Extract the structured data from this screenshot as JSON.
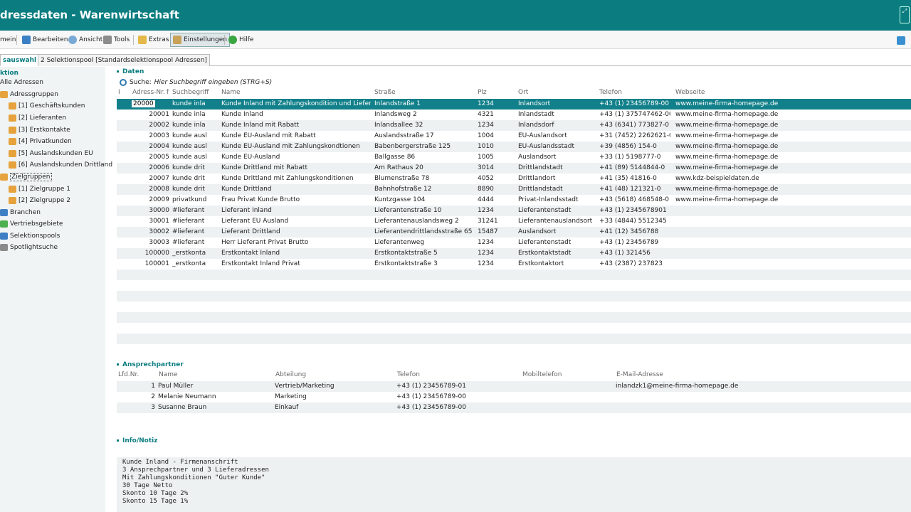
{
  "window": {
    "title": "dressdaten - Warenwirtschaft",
    "restore_glyph": "⤢"
  },
  "menubar": [
    {
      "label": "mein",
      "icon": ""
    },
    {
      "label": "Bearbeiten",
      "icon": "edit-icon"
    },
    {
      "label": "Ansicht",
      "icon": "view-icon"
    },
    {
      "label": "Tools",
      "icon": "tools-icon"
    },
    {
      "label": "Extras",
      "icon": "extras-icon"
    },
    {
      "label": "Einstellungen",
      "icon": "settings-icon"
    },
    {
      "label": "Hilfe",
      "icon": "help-icon"
    }
  ],
  "tabs": [
    {
      "label": "sauswahl"
    },
    {
      "label": "2 Selektionspool [Standardselektionspool Adressen]"
    }
  ],
  "sidebar": {
    "heading": "ktion",
    "items": [
      {
        "label": "Alle Adressen"
      },
      {
        "label": "Adressgruppen"
      },
      {
        "label": "[1] Geschäftskunden"
      },
      {
        "label": "[2] Lieferanten"
      },
      {
        "label": "[3] Erstkontakte"
      },
      {
        "label": "[4] Privatkunden"
      },
      {
        "label": "[5] Auslandskunden EU"
      },
      {
        "label": "[6] Auslandskunden Drittland"
      },
      {
        "label": "Zielgruppen"
      },
      {
        "label": "[1] Zielgruppe 1"
      },
      {
        "label": "[2] Zielgruppe 2"
      },
      {
        "label": "Branchen"
      },
      {
        "label": "Vertriebsgebiete"
      },
      {
        "label": "Selektionspools"
      },
      {
        "label": "Spotlightsuche"
      }
    ]
  },
  "daten": {
    "heading": "Daten",
    "search_label": "Suche:",
    "search_hint": "Hier Suchbegriff eingeben (STRG+S)",
    "columns": [
      "I",
      "Adress-Nr.↑",
      "Suchbegriff",
      "Name",
      "Straße",
      "Plz",
      "Ort",
      "Telefon",
      "Webseite"
    ],
    "rows": [
      [
        "20000",
        "kunde inla",
        "Kunde Inland mit Zahlungskondition und Lieferadr.",
        "Inlandstraße 1",
        "1234",
        "Inlandsort",
        "+43 (1) 23456789-00",
        "www.meine-firma-homepage.de"
      ],
      [
        "20001",
        "kunde inla",
        "Kunde Inland",
        "Inlandsweg 2",
        "4321",
        "Inlandstadt",
        "+43 (1) 375747462-00",
        "www.meine-firma-homepage.de"
      ],
      [
        "20002",
        "kunde inla",
        "Kunde Inland mit Rabatt",
        "Inlandsallee 32",
        "1234",
        "Inlandsdorf",
        "+43 (6341) 773827-0",
        "www.meine-firma-homepage.de"
      ],
      [
        "20003",
        "kunde ausl",
        "Kunde EU-Ausland mit Rabatt",
        "Auslandsstraße 17",
        "1004",
        "EU-Auslandsort",
        "+31 (7452) 2262621-0",
        "www.meine-firma-homepage.de"
      ],
      [
        "20004",
        "kunde ausl",
        "Kunde EU-Ausland mit Zahlungskondtionen",
        "Babenbergerstraße 125",
        "1010",
        "EU-Auslandsstadt",
        "+39 (4856) 154-0",
        "www.meine-firma-homepage.de"
      ],
      [
        "20005",
        "kunde ausl",
        "Kunde EU-Ausland",
        "Ballgasse 86",
        "1005",
        "Auslandsort",
        "+33 (1) 5198777-0",
        "www.meine-firma-homepage.de"
      ],
      [
        "20006",
        "kunde drit",
        "Kunde Drittland mit Rabatt",
        "Am Rathaus 20",
        "3014",
        "Drittlandstadt",
        "+41 (89) 5144844-0",
        "www.meine-firma-homepage.de"
      ],
      [
        "20007",
        "kunde drit",
        "Kunde Drittland mit Zahlungskonditionen",
        "Blumenstraße 78",
        "4052",
        "Drittlandort",
        "+41 (35) 41816-0",
        "www.kdz-beispieldaten.de"
      ],
      [
        "20008",
        "kunde drit",
        "Kunde Drittland",
        "Bahnhofstraße 12",
        "8890",
        "Drittlandstadt",
        "+41 (48) 121321-0",
        "www.meine-firma-homepage.de"
      ],
      [
        "20009",
        "privatkund",
        "Frau Privat Kunde Brutto",
        "Kuntzgasse 104",
        "4444",
        "Privat-Inlandsstadt",
        "+43 (5618) 468548-0",
        "www.meine-firma-homepage.de"
      ],
      [
        "30000",
        "#lieferant",
        "Lieferant Inland",
        "Lieferantenstraße 10",
        "1234",
        "Lieferantenstadt",
        "+43 (1) 2345678901",
        ""
      ],
      [
        "30001",
        "#lieferant",
        "Lieferant EU Ausland",
        "Lieferantenauslandsweg 2",
        "31241",
        "Lieferantenauslandsort",
        "+33 (4844) 5512345",
        ""
      ],
      [
        "30002",
        "#lieferant",
        "Lieferant Drittland",
        "Lieferantendrittlandsstraße 65",
        "15487",
        "Auslandsort",
        "+41 (12) 3456788",
        ""
      ],
      [
        "30003",
        "#lieferant",
        "Herr Lieferant Privat Brutto",
        "Lieferantenweg",
        "1234",
        "Lieferantenstadt",
        "+43 (1) 23456789",
        ""
      ],
      [
        "100000",
        "_erstkonta",
        "Erstkontakt Inland",
        "Erstkontaktstraße 5",
        "1234",
        "Erstkontaktstadt",
        "+43 (1) 321456",
        ""
      ],
      [
        "100001",
        "_erstkonta",
        "Erstkontakt Inland Privat",
        "Erstkontaktstraße 3",
        "1234",
        "Erstkontaktort",
        "+43 (2387) 237823",
        ""
      ]
    ]
  },
  "ansprech": {
    "heading": "Ansprechpartner",
    "columns": [
      "Lfd.Nr.",
      "Name",
      "Abteilung",
      "Telefon",
      "Mobiltelefon",
      "E-Mail-Adresse"
    ],
    "rows": [
      [
        "1",
        "Paul Müller",
        "Vertrieb/Marketing",
        "+43 (1) 23456789-01",
        "",
        "inlandzk1@meine-firma-homepage.de"
      ],
      [
        "2",
        "Melanie Neumann",
        "Marketing",
        "+43 (1) 23456789-00",
        "",
        ""
      ],
      [
        "3",
        "Susanne Braun",
        "Einkauf",
        "+43 (1) 23456789-00",
        "",
        ""
      ]
    ]
  },
  "info": {
    "heading": "Info/Notiz",
    "lines": [
      "Kunde Inland - Firmenanschrift",
      "3 Ansprechpartner und 3 Lieferadressen",
      "Mit Zahlungskonditionen \"Guter Kunde\"",
      "30 Tage Netto",
      "Skonto 10 Tage 2%",
      "Skonto 15 Tage 1%"
    ]
  }
}
